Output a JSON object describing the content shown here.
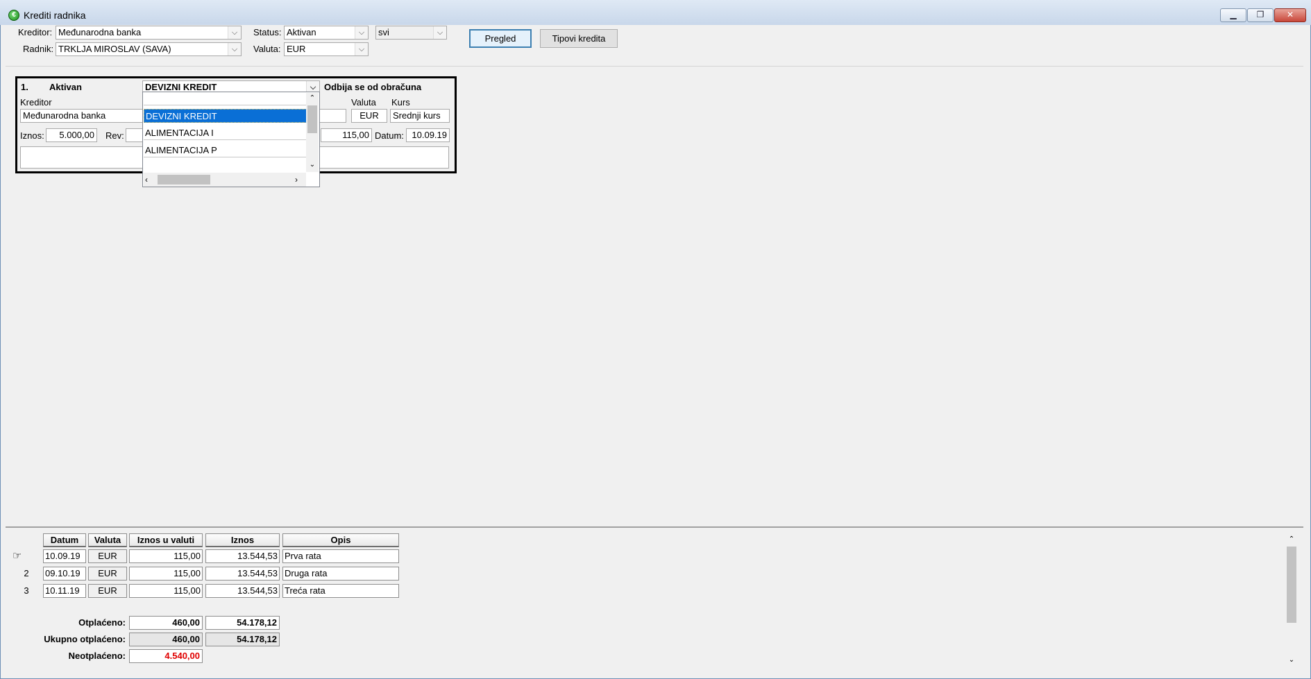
{
  "window": {
    "title": "Krediti radnika",
    "icon": "app-logo-icon",
    "controls": [
      "minimize-icon",
      "restore-icon",
      "close-icon"
    ],
    "minimize_glyph": "▁",
    "restore_glyph": "❐",
    "close_glyph": "✕"
  },
  "filters": {
    "kreditor_label": "Kreditor:",
    "kreditor_value": "Međunarodna banka",
    "radnik_label": "Radnik:",
    "radnik_value": "TRKLJA MIROSLAV (SAVA)",
    "status_label": "Status:",
    "status_value": "Aktivan",
    "valuta_label": "Valuta:",
    "valuta_value": "EUR",
    "extra_value": "svi",
    "pregled_button": "Pregled",
    "tipovi_button": "Tipovi kredita"
  },
  "card": {
    "number": "1.",
    "status": "Aktivan",
    "type_value": "DEVIZNI KREDIT",
    "deduction_note": "Odbija se od obračuna",
    "kreditor_label": "Kreditor",
    "kreditor_value": "Međunarodna banka",
    "valuta_label": "Valuta",
    "valuta_value": "EUR",
    "kurs_label": "Kurs",
    "kurs_value": "Srednji kurs",
    "iznos_label": "Iznos:",
    "iznos_value": "5.000,00",
    "rev_label": "Rev:",
    "rata_value": "115,00",
    "datum_label": "Datum:",
    "datum_value": "10.09.19"
  },
  "dropdown": {
    "items": [
      "DEVIZNI KREDIT",
      "ALIMENTACIJA I",
      "ALIMENTACIJA P"
    ],
    "selected_index": 0
  },
  "payments": {
    "headers": [
      "Datum",
      "Valuta",
      "Iznos u valuti",
      "Iznos",
      "Opis"
    ],
    "rows": [
      {
        "num": "",
        "datum": "10.09.19",
        "valuta": "EUR",
        "iznos_valuta": "115,00",
        "iznos": "13.544,53",
        "opis": "Prva rata"
      },
      {
        "num": "2",
        "datum": "09.10.19",
        "valuta": "EUR",
        "iznos_valuta": "115,00",
        "iznos": "13.544,53",
        "opis": "Druga rata"
      },
      {
        "num": "3",
        "datum": "10.11.19",
        "valuta": "EUR",
        "iznos_valuta": "115,00",
        "iznos": "13.544,53",
        "opis": "Treća rata"
      }
    ],
    "current_row_icon": "pointing-hand-icon",
    "summary": {
      "otplaceno_label": "Otplaćeno:",
      "otplaceno_valuta": "460,00",
      "otplaceno_iznos": "54.178,12",
      "ukupno_label": "Ukupno otplaćeno:",
      "ukupno_valuta": "460,00",
      "ukupno_iznos": "54.178,12",
      "neotplaceno_label": "Neotplaćeno:",
      "neotplaceno_valuta": "4.540,00"
    },
    "colors": {
      "neotplaceno": "#e00000",
      "selection": "#0a6fd6"
    }
  }
}
